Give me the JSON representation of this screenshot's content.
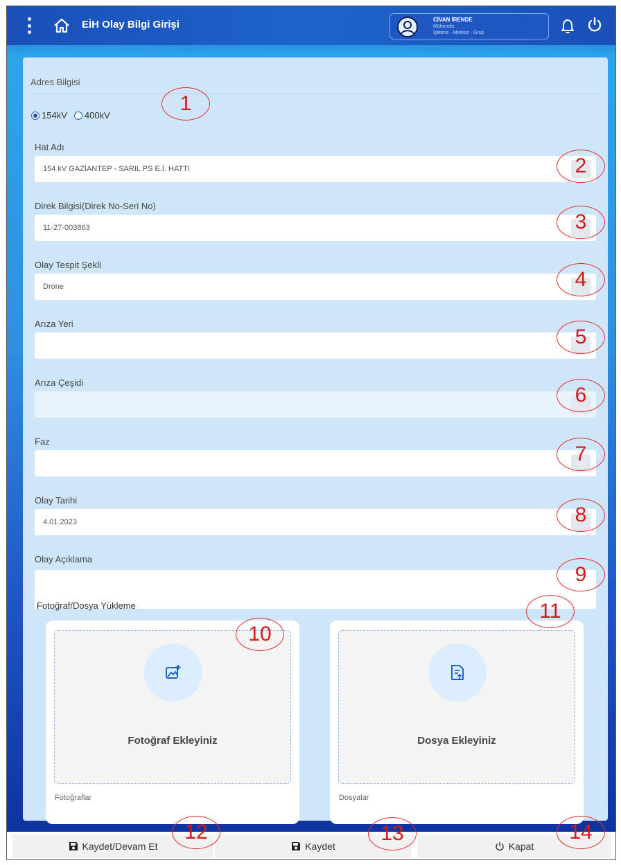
{
  "header": {
    "title": "EİH Olay Bilgi Girişi",
    "user_name": "CİVAN İRENDE",
    "user_role": "Mühendis",
    "user_unit": "İşletme - Merkez - Grup"
  },
  "form": {
    "section_title": "Adres Bilgisi",
    "voltage_options": [
      {
        "label": "154kV",
        "selected": true
      },
      {
        "label": "400kV",
        "selected": false
      }
    ],
    "fields": [
      {
        "label": "Hat Adı",
        "value": "154 kV GAZİANTEP - SARIL PS E.İ. HATTI"
      },
      {
        "label": "Direk Bilgisi(Direk No-Seri No)",
        "value": "11-27-003863"
      },
      {
        "label": "Olay Tespit Şekli",
        "value": "Drone"
      },
      {
        "label": "Arıza Yeri",
        "value": ""
      },
      {
        "label": "Arıza Çeşidi",
        "value": ""
      },
      {
        "label": "Faz",
        "value": ""
      },
      {
        "label": "Olay Tarihi",
        "value": "4.01.2023"
      },
      {
        "label": "Olay Açıklama",
        "value": ""
      }
    ]
  },
  "upload": {
    "title": "Fotoğraf/Dosya Yükleme",
    "photo": {
      "label": "Fotoğraf Ekleyiniz",
      "caption": "Fotoğraflar"
    },
    "file": {
      "label": "Dosya Ekleyiniz",
      "caption": "Dosyalar"
    }
  },
  "footer": {
    "save_continue": "Kaydet/Devam Et",
    "save": "Kaydet",
    "close": "Kapat"
  },
  "annotations": [
    "1",
    "2",
    "3",
    "4",
    "5",
    "6",
    "7",
    "8",
    "9",
    "10",
    "11",
    "12",
    "13",
    "14"
  ],
  "colors": {
    "header_blue": "#1e63cc",
    "panel_bg": "#cfe6f8",
    "annotation_red": "#e52b2b"
  }
}
